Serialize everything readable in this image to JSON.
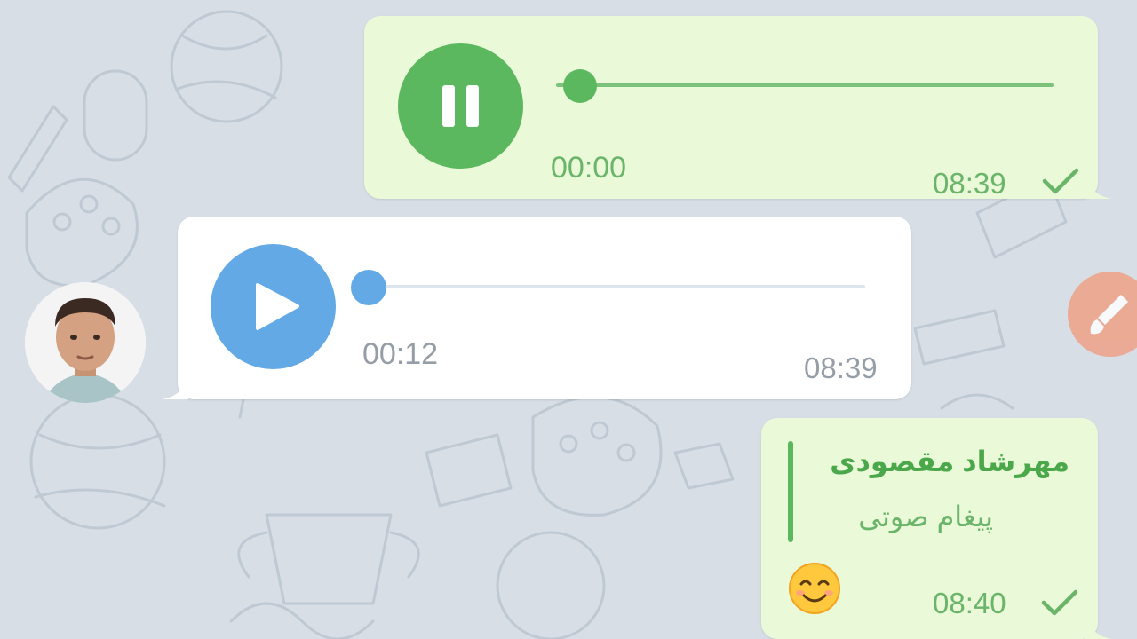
{
  "colors": {
    "background": "#d7dee6",
    "outgoing_bubble": "#eaf9d8",
    "incoming_bubble": "#ffffff",
    "outgoing_accent": "#5cb85e",
    "incoming_accent": "#63a9e5",
    "fab": "#ef9f82"
  },
  "messages": [
    {
      "direction": "outgoing",
      "type": "voice",
      "control_icon": "pause-icon",
      "duration": "00:00",
      "progress": 0.0,
      "time": "08:39",
      "status_icon": "check-icon"
    },
    {
      "direction": "incoming",
      "type": "voice",
      "control_icon": "play-icon",
      "duration": "00:12",
      "progress": 0.0,
      "time": "08:39",
      "sender_avatar_icon": "avatar-photo"
    },
    {
      "direction": "outgoing",
      "type": "reply",
      "reply_to_name": "مهرشاد مقصودی",
      "reply_to_text": "پیغام صوتی",
      "content_icon": "smiling-face-emoji",
      "time": "08:40",
      "status_icon": "check-icon"
    }
  ],
  "floating_button_icon": "brush-icon"
}
